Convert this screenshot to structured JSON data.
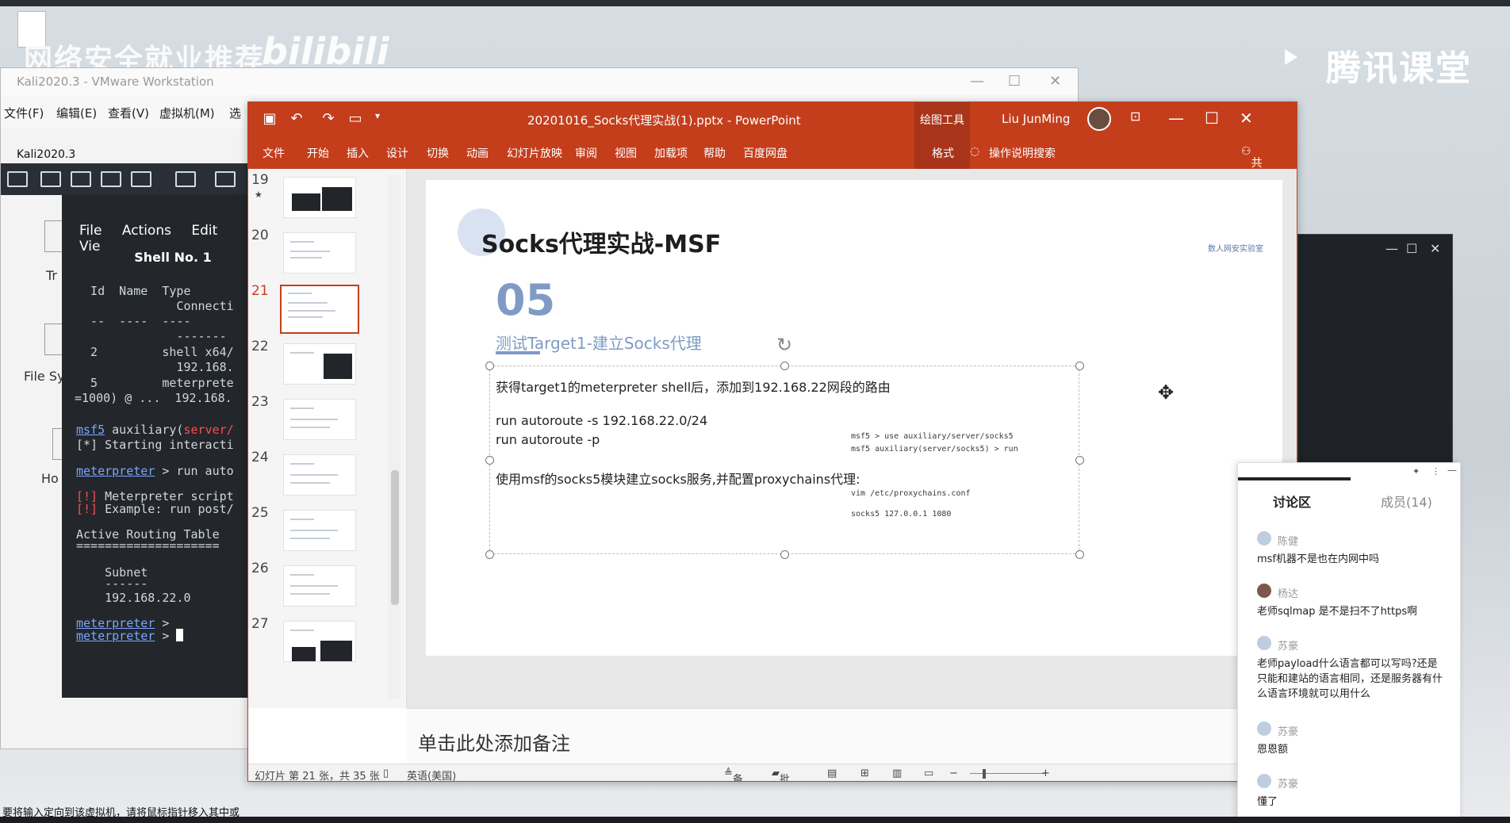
{
  "background": {
    "watermark_left": "网络安全就业推荐",
    "watermark_logo": "bilibili",
    "watermark_right": "腾讯课堂"
  },
  "vmware": {
    "title": "Kali2020.3 - VMware Workstation",
    "menu": [
      "文件(F)",
      "编辑(E)",
      "查看(V)",
      "虚拟机(M)",
      "选"
    ],
    "tab": "Kali2020.3",
    "status": "要将输入定向到该虚拟机，请将鼠标指针移入其中或"
  },
  "desktop": {
    "icons": [
      {
        "label": "Tr"
      },
      {
        "label": "File Sy"
      },
      {
        "label": "Ho"
      }
    ]
  },
  "terminal": {
    "menu": [
      "File",
      "Actions",
      "Edit",
      "Vie"
    ],
    "title": "Shell No. 1",
    "lines": [
      "  Id  Name  Type",
      "              Connecti",
      "  --  ----  ----",
      "              -------",
      "  2         shell x64/",
      "              192.168.",
      "  5         meterprete",
      "=1000) @ ...  192.168."
    ],
    "prompt_msf": "msf5",
    "prompt_aux": " auxiliary(",
    "prompt_aux_red": "server/",
    "starting": "[*] Starting interacti",
    "meterpreter": "meterpreter",
    "run_cmd": " > run auto",
    "warn1_tag": "[!]",
    "warn1": " Meterpreter script",
    "warn2_tag": "[!]",
    "warn2": " Example: run post/",
    "routing": "Active Routing Table",
    "routing_ul": "====================",
    "subnet_hdr": "    Subnet",
    "subnet_ul": "    ------",
    "subnet_val": "    192.168.22.0",
    "prompt_end": " >"
  },
  "ppt": {
    "title": "20201016_Socks代理实战(1).pptx  -  PowerPoint",
    "drawing_tools": "绘图工具",
    "user": "Liu JunMing",
    "ribbon": [
      "文件",
      "开始",
      "插入",
      "设计",
      "切换",
      "动画",
      "幻灯片放映",
      "审阅",
      "视图",
      "加载项",
      "帮助",
      "百度网盘",
      "格式",
      "操作说明搜索",
      "共享"
    ],
    "thumbnails": [
      "19",
      "20",
      "21",
      "22",
      "23",
      "24",
      "25",
      "26",
      "27"
    ],
    "thumb_star": "★",
    "slide": {
      "title": "Socks代理实战-MSF",
      "brand": "数人网安实验室",
      "number": "05",
      "subtitle": "测试Target1-建立Socks代理",
      "line1": "获得target1的meterpreter shell后，添加到192.168.22网段的路由",
      "line2": "run autoroute -s 192.168.22.0/24",
      "line3": "run autoroute -p",
      "line4": "使用msf的socks5模块建立socks服务,并配置proxychains代理:",
      "code1": "msf5 > use auxiliary/server/socks5",
      "code2": "msf5 auxiliary(server/socks5) > run",
      "code3": "vim /etc/proxychains.conf",
      "code4": "socks5  127.0.0.1 1080"
    },
    "notes_placeholder": "单击此处添加备注",
    "status": {
      "slide_info": "幻灯片 第 21 张，共 35 张",
      "language": "英语(美国)",
      "notes": "备注",
      "comments": "批注",
      "zoom_minus": "−",
      "zoom_plus": "+"
    }
  },
  "discussion": {
    "tab_active": "讨论区",
    "tab_members": "成员(14)",
    "messages": [
      {
        "user": "陈健",
        "text": "msf机器不是也在内网中吗"
      },
      {
        "user": "杨达",
        "text": "老师sqlmap 是不是扫不了https啊"
      },
      {
        "user": "苏豪",
        "text": "老师payload什么语言都可以写吗?还是只能和建站的语言相同，还是服务器有什么语言环境就可以用什么"
      },
      {
        "user": "苏豪",
        "text": "恩恩额"
      },
      {
        "user": "苏豪",
        "text": "懂了"
      }
    ]
  }
}
